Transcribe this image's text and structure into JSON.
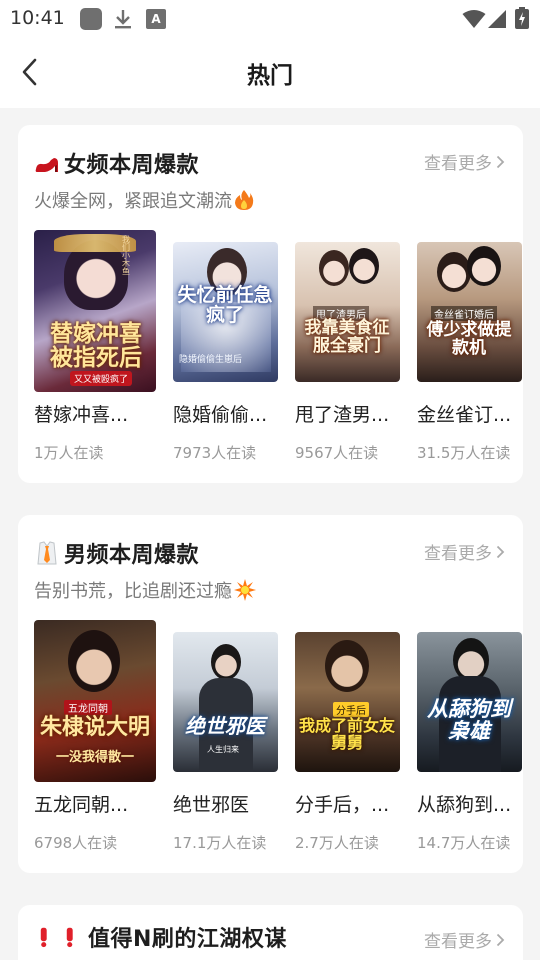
{
  "status_bar": {
    "time": "10:41",
    "notif_letter": "A"
  },
  "header": {
    "title": "热门"
  },
  "sections": [
    {
      "title": "女频本周爆款",
      "subtitle": "火爆全网，紧跟追文潮流",
      "more_label": "查看更多",
      "books": [
        {
          "name": "替嫁冲喜...",
          "reads": "1万人在读",
          "cover_text": "替嫁冲喜被指死后",
          "cover_small": "又又被殴疯了",
          "cover_top": "我们小木鱼"
        },
        {
          "name": "隐婚偷偷...",
          "reads": "7973人在读",
          "cover_text": "失忆前任急疯了",
          "cover_small": "隐婚偷偷生崽后"
        },
        {
          "name": "甩了渣男...",
          "reads": "9567人在读",
          "cover_text": "我靠美食征服全豪门",
          "cover_small": "甩了渣男后"
        },
        {
          "name": "金丝雀订...",
          "reads": "31.5万人在读",
          "cover_text": "傅少求做提款机",
          "cover_small": "金丝雀订婚后"
        }
      ]
    },
    {
      "title": "男频本周爆款",
      "subtitle": "告别书荒，比追剧还过瘾",
      "more_label": "查看更多",
      "books": [
        {
          "name": "五龙同朝...",
          "reads": "6798人在读",
          "cover_text": "朱棣说大明",
          "cover_small": "五龙同朝",
          "cover_bottom": "一没我得散一"
        },
        {
          "name": "绝世邪医",
          "reads": "17.1万人在读",
          "cover_text": "绝世邪医",
          "cover_small": "人生归来"
        },
        {
          "name": "分手后，...",
          "reads": "2.7万人在读",
          "cover_text": "我成了前女友舅舅",
          "cover_small": "分手后"
        },
        {
          "name": "从舔狗到...",
          "reads": "14.7万人在读",
          "cover_text": "从舔狗到枭雄",
          "cover_small": ""
        }
      ]
    },
    {
      "title": "值得N刷的江湖权谋",
      "more_label": "查看更多"
    }
  ],
  "colors": {
    "accent_text": "#1e1e1e",
    "muted": "#aaaaaa",
    "card_bg": "#ffffff",
    "page_bg": "#f4f4f4"
  }
}
